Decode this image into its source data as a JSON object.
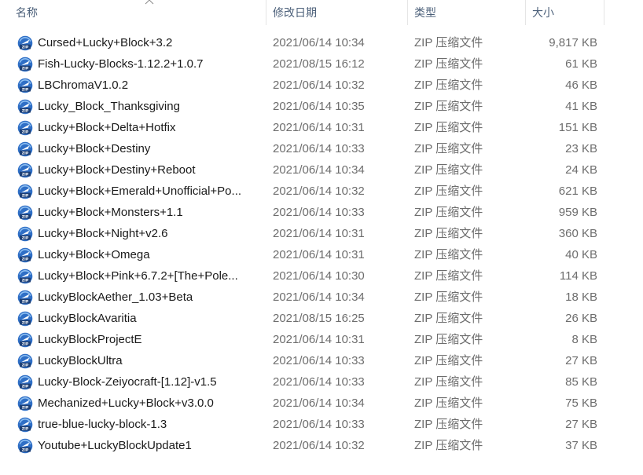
{
  "columns": {
    "name": "名称",
    "date": "修改日期",
    "type": "类型",
    "size": "大小"
  },
  "sort": {
    "column": "name",
    "icon": "chevron-up-icon"
  },
  "file_icon": "zip-archive-icon",
  "files": [
    {
      "name": "Cursed+Lucky+Block+3.2",
      "date": "2021/06/14 10:34",
      "type": "ZIP 压缩文件",
      "size": "9,817 KB"
    },
    {
      "name": "Fish-Lucky-Blocks-1.12.2+1.0.7",
      "date": "2021/08/15 16:12",
      "type": "ZIP 压缩文件",
      "size": "61 KB"
    },
    {
      "name": "LBChromaV1.0.2",
      "date": "2021/06/14 10:32",
      "type": "ZIP 压缩文件",
      "size": "46 KB"
    },
    {
      "name": "Lucky_Block_Thanksgiving",
      "date": "2021/06/14 10:35",
      "type": "ZIP 压缩文件",
      "size": "41 KB"
    },
    {
      "name": "Lucky+Block+Delta+Hotfix",
      "date": "2021/06/14 10:31",
      "type": "ZIP 压缩文件",
      "size": "151 KB"
    },
    {
      "name": "Lucky+Block+Destiny",
      "date": "2021/06/14 10:33",
      "type": "ZIP 压缩文件",
      "size": "23 KB"
    },
    {
      "name": "Lucky+Block+Destiny+Reboot",
      "date": "2021/06/14 10:34",
      "type": "ZIP 压缩文件",
      "size": "24 KB"
    },
    {
      "name": "Lucky+Block+Emerald+Unofficial+Po...",
      "date": "2021/06/14 10:32",
      "type": "ZIP 压缩文件",
      "size": "621 KB"
    },
    {
      "name": "Lucky+Block+Monsters+1.1",
      "date": "2021/06/14 10:33",
      "type": "ZIP 压缩文件",
      "size": "959 KB"
    },
    {
      "name": "Lucky+Block+Night+v2.6",
      "date": "2021/06/14 10:31",
      "type": "ZIP 压缩文件",
      "size": "360 KB"
    },
    {
      "name": "Lucky+Block+Omega",
      "date": "2021/06/14 10:31",
      "type": "ZIP 压缩文件",
      "size": "40 KB"
    },
    {
      "name": "Lucky+Block+Pink+6.7.2+[The+Pole...",
      "date": "2021/06/14 10:30",
      "type": "ZIP 压缩文件",
      "size": "114 KB"
    },
    {
      "name": "LuckyBlockAether_1.03+Beta",
      "date": "2021/06/14 10:34",
      "type": "ZIP 压缩文件",
      "size": "18 KB"
    },
    {
      "name": "LuckyBlockAvaritia",
      "date": "2021/08/15 16:25",
      "type": "ZIP 压缩文件",
      "size": "26 KB"
    },
    {
      "name": "LuckyBlockProjectE",
      "date": "2021/06/14 10:31",
      "type": "ZIP 压缩文件",
      "size": "8 KB"
    },
    {
      "name": "LuckyBlockUltra",
      "date": "2021/06/14 10:33",
      "type": "ZIP 压缩文件",
      "size": "27 KB"
    },
    {
      "name": "Lucky-Block-Zeiyocraft-[1.12]-v1.5",
      "date": "2021/06/14 10:33",
      "type": "ZIP 压缩文件",
      "size": "85 KB"
    },
    {
      "name": "Mechanized+Lucky+Block+v3.0.0",
      "date": "2021/06/14 10:34",
      "type": "ZIP 压缩文件",
      "size": "75 KB"
    },
    {
      "name": "true-blue-lucky-block-1.3",
      "date": "2021/06/14 10:33",
      "type": "ZIP 压缩文件",
      "size": "27 KB"
    },
    {
      "name": "Youtube+LuckyBlockUpdate1",
      "date": "2021/06/14 10:32",
      "type": "ZIP 压缩文件",
      "size": "37 KB"
    }
  ]
}
